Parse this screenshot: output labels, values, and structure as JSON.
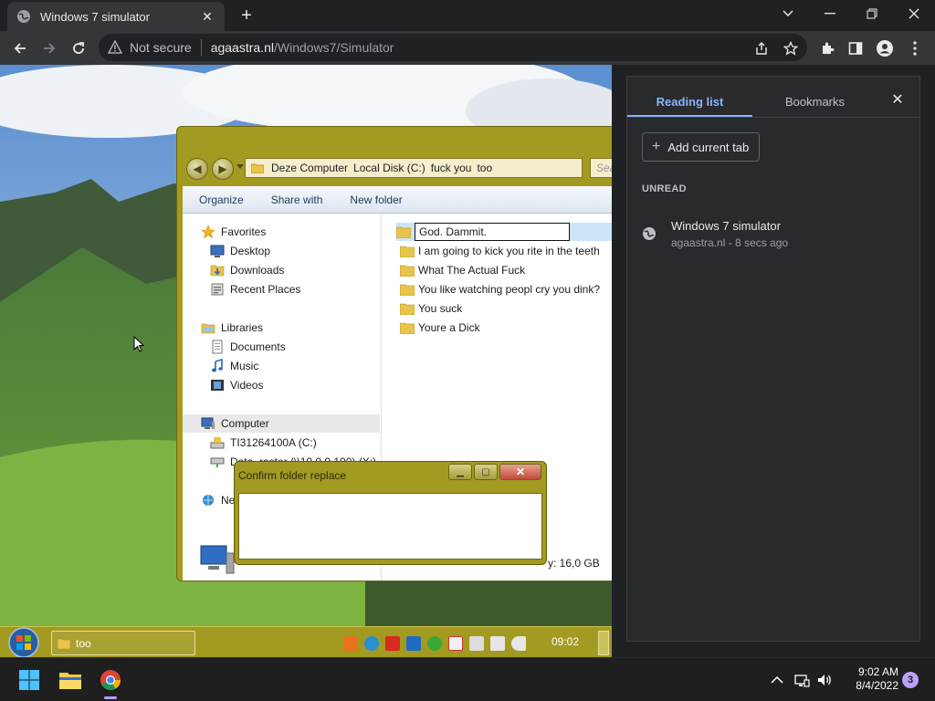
{
  "browser": {
    "tab_title": "Windows 7 simulator",
    "not_secure": "Not secure",
    "url_host": "agaastra.nl",
    "url_path": "/Windows7/Simulator"
  },
  "explorer": {
    "breadcrumb": [
      "Deze Computer",
      "Local Disk (C:)",
      "fuck you",
      "too"
    ],
    "search_placeholder": "Sea",
    "commands": [
      "Organize",
      "Share with",
      "New folder"
    ],
    "nav": {
      "favorites": "Favorites",
      "desktop": "Desktop",
      "downloads": "Downloads",
      "recent": "Recent Places",
      "libraries": "Libraries",
      "documents": "Documents",
      "music": "Music",
      "videos": "Videos",
      "computer": "Computer",
      "drive": "TI31264100A (C:)",
      "network_drive": "Data, raster (\\\\10.0.0.100) (X:)",
      "network": "Network"
    },
    "rename_value": "God. Dammit.",
    "files": [
      "I am going to kick you rite in the teeth",
      "What The Actual Fuck",
      "You like watching peopl cry you dink?",
      "You suck",
      "Youre a Dick"
    ],
    "free_space": "y: 16,0 GB"
  },
  "dialog": {
    "title": "Confirm folder replace"
  },
  "w7_taskbar": {
    "app_label": "too",
    "clock": "09:02"
  },
  "side_panel": {
    "tab_reading": "Reading list",
    "tab_bookmarks": "Bookmarks",
    "add_button": "Add current tab",
    "section": "UNREAD",
    "item_title": "Windows 7 simulator",
    "item_meta": "agaastra.nl - 8 secs ago"
  },
  "win_taskbar": {
    "time": "9:02 AM",
    "date": "8/4/2022",
    "notification_count": "3"
  },
  "colors": {
    "accent_blue": "#8ab4f8",
    "olive_theme": "#a39a22",
    "chrome_dark": "#202124"
  }
}
